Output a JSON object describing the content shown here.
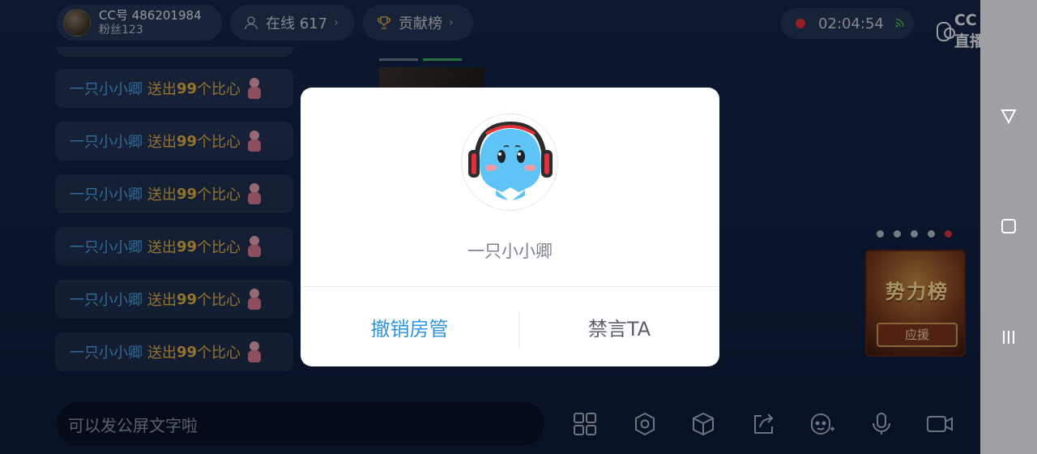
{
  "top_bar": {
    "anchor_id": "CC号 486201984",
    "anchor_fans": "粉丝123",
    "online_label": "在线 617",
    "rank_label": "贡献榜",
    "live_timer": "02:04:54",
    "logo_text": "CC直播"
  },
  "chat": {
    "messages": [
      {
        "user": "一只小小卿",
        "verb": "送出",
        "amount": "99",
        "gift": "个比心"
      },
      {
        "user": "一只小小卿",
        "verb": "送出",
        "amount": "99",
        "gift": "个比心"
      },
      {
        "user": "一只小小卿",
        "verb": "送出",
        "amount": "99",
        "gift": "个比心"
      },
      {
        "user": "一只小小卿",
        "verb": "送出",
        "amount": "99",
        "gift": "个比心"
      },
      {
        "user": "一只小小卿",
        "verb": "送出",
        "amount": "99",
        "gift": "个比心"
      },
      {
        "user": "一只小小卿",
        "verb": "送出",
        "amount": "99",
        "gift": "个比心"
      }
    ]
  },
  "rank_card": {
    "title": "势力榜",
    "button": "应援"
  },
  "input": {
    "placeholder": "可以发公屏文字啦"
  },
  "modal": {
    "name": "一只小小卿",
    "revoke_button": "撤销房管",
    "mute_button": "禁言TA"
  },
  "colors": {
    "accent_blue": "#2e95e0",
    "gift_gold": "#e0b24a",
    "user_blue": "#4aa6e8",
    "record_red": "#e0303a"
  },
  "icons": [
    "user-icon",
    "trophy-icon",
    "chevron-right-icon",
    "record-dot-icon",
    "signal-icon",
    "grid-icon",
    "settings-icon",
    "cube-icon",
    "share-icon",
    "emoji-icon",
    "mic-icon",
    "video-icon",
    "back-triangle-icon",
    "home-square-icon",
    "recents-icon"
  ]
}
